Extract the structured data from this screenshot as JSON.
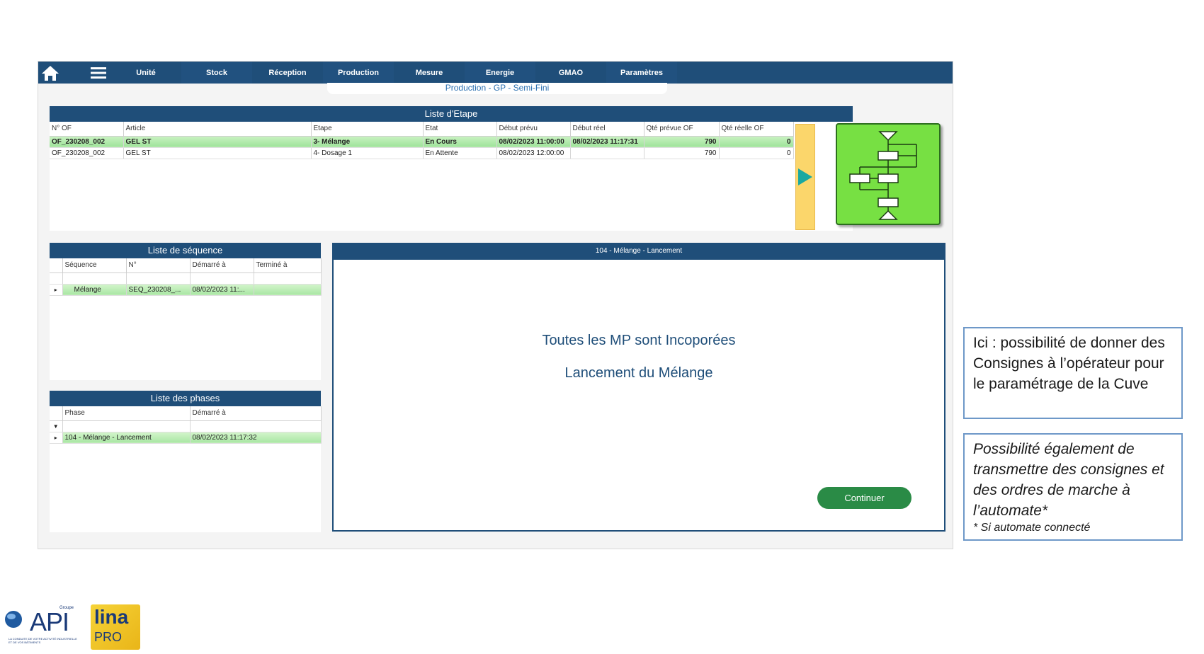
{
  "navbar": {
    "tabs": [
      "Unité",
      "Stock",
      "Réception",
      "Production",
      "Mesure",
      "Energie",
      "GMAO",
      "Paramètres"
    ]
  },
  "subtitle": "Production - GP - Semi-Fini",
  "etapes": {
    "title": "Liste d'Etape",
    "columns": [
      "N° OF",
      "Article",
      "Etape",
      "Etat",
      "Début prévu",
      "Début réel",
      "Qté prévue OF",
      "Qté réelle OF"
    ],
    "rows": [
      [
        "OF_230208_002",
        "GEL ST",
        "3- Mélange",
        "En Cours",
        "08/02/2023 11:00:00",
        "08/02/2023 11:17:31",
        "790",
        "0"
      ],
      [
        "OF_230208_002",
        "GEL ST",
        "4- Dosage 1",
        "En Attente",
        "08/02/2023 12:00:00",
        "",
        "790",
        "0"
      ]
    ]
  },
  "sequences": {
    "title": "Liste de séquence",
    "columns": [
      "Séquence",
      "N°",
      "Démarré à",
      "Terminé à"
    ],
    "rows": [
      [
        "Mélange",
        "SEQ_230208_...",
        "08/02/2023 11:...",
        ""
      ]
    ]
  },
  "phases": {
    "title": "Liste des phases",
    "columns": [
      "Phase",
      "Démarré à"
    ],
    "rows": [
      [
        "104 - Mélange - Lancement",
        "08/02/2023 11:17:32"
      ]
    ]
  },
  "dialog": {
    "title": "104 - Mélange - Lancement",
    "message_1": "Toutes les MP sont Incoporées",
    "message_2": "Lancement du Mélange",
    "continue_label": "Continuer"
  },
  "callouts": {
    "first": "Ici : possibilité de donner des Consignes à l’opérateur pour le paramétrage de la Cuve",
    "second": "Possibilité également de transmettre des consignes et des ordres de marche à l’automate*",
    "second_note": "* Si automate connecté"
  },
  "logos": {
    "api_group": "Groupe",
    "api": "API",
    "api_tagline": "LA CONDUITE DE VOTRE ACTIVITÉ INDUSTRIELLE ET DE VOS BÂTIMENTS",
    "lina": "lina",
    "lina_pro": "PRO"
  },
  "colors": {
    "navbar": "#1f4e79",
    "active_row": "#a9e6a4",
    "continue_button": "#2a8b46",
    "flow_icon": "#77e043",
    "side_strip": "#fbd66b"
  }
}
